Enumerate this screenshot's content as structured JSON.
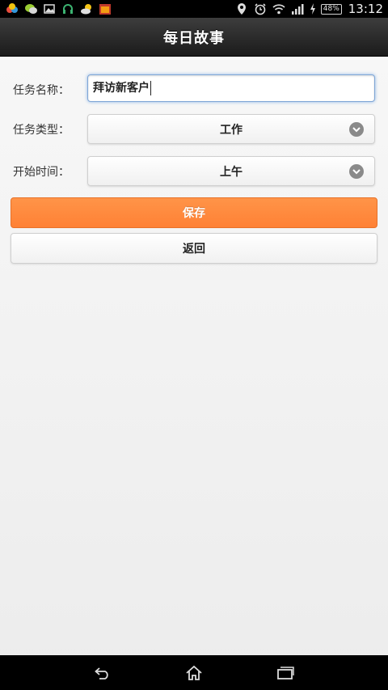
{
  "status_bar": {
    "battery": "48%",
    "time": "13:12"
  },
  "header": {
    "title": "每日故事"
  },
  "form": {
    "task_name_label": "任务名称：",
    "task_name_value": "拜访新客户",
    "task_type_label": "任务类型：",
    "task_type_value": "工作",
    "start_time_label": "开始时间：",
    "start_time_value": "上午"
  },
  "buttons": {
    "save": "保存",
    "back": "返回"
  },
  "colors": {
    "save_button": "#ff8a3d",
    "header_bg": "#1f1f1f"
  },
  "icons": {
    "status_left": [
      "app-icon",
      "chat-icon",
      "image-icon",
      "headset-icon",
      "weather-icon",
      "calendar-icon"
    ],
    "status_right": [
      "location-icon",
      "alarm-icon",
      "wifi-icon",
      "signal-icon",
      "charging-icon"
    ],
    "nav": [
      "back-icon",
      "home-icon",
      "recent-apps-icon"
    ]
  }
}
